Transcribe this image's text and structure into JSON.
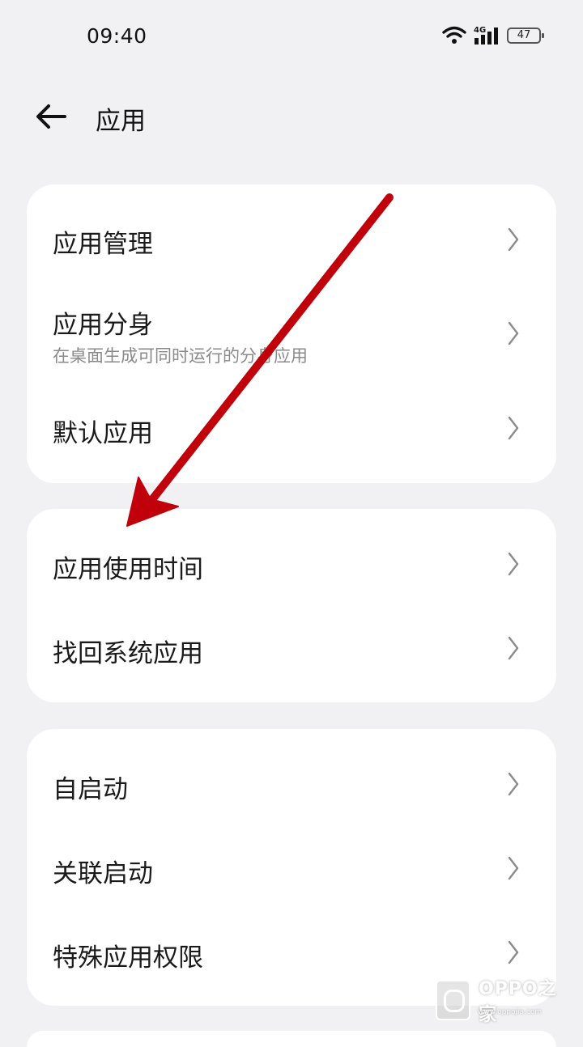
{
  "status_bar": {
    "time": "09:40",
    "network": "4G",
    "battery": "47",
    "icons": [
      "wifi-icon",
      "signal-icon",
      "battery-icon"
    ]
  },
  "header": {
    "back_icon": "arrow-left-icon",
    "title": "应用"
  },
  "groups": [
    {
      "items": [
        {
          "title": "应用管理"
        },
        {
          "title": "应用分身",
          "subtitle": "在桌面生成可同时运行的分身应用"
        },
        {
          "title": "默认应用"
        }
      ]
    },
    {
      "items": [
        {
          "title": "应用使用时间"
        },
        {
          "title": "找回系统应用"
        }
      ]
    },
    {
      "items": [
        {
          "title": "自启动"
        },
        {
          "title": "关联启动"
        },
        {
          "title": "特殊应用权限"
        }
      ]
    }
  ],
  "watermark": {
    "text": "OPPO之家",
    "url": "www.oppojia.com"
  },
  "colors": {
    "background": "#f1f1f3",
    "card": "#ffffff",
    "annotation_arrow": "#c0000a",
    "chevron": "#8c8c8c"
  }
}
